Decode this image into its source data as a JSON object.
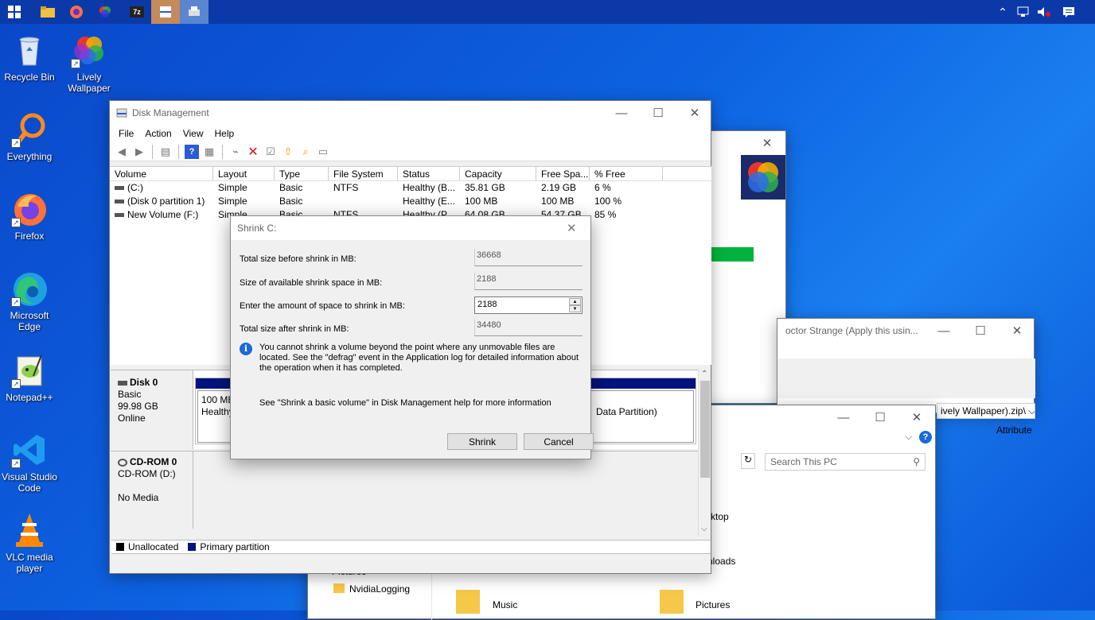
{
  "desktop_icons": [
    {
      "label": "Recycle Bin",
      "icon": "recycle-bin-icon"
    },
    {
      "label": "Lively Wallpaper",
      "icon": "lively-wallpaper-icon"
    },
    {
      "label": "Everything",
      "icon": "everything-search-icon"
    },
    {
      "label": "Firefox",
      "icon": "firefox-icon"
    },
    {
      "label": "Microsoft Edge",
      "icon": "edge-icon"
    },
    {
      "label": "Notepad++",
      "icon": "notepadpp-icon"
    },
    {
      "label": "Visual Studio Code",
      "icon": "vscode-icon"
    },
    {
      "label": "VLC media player",
      "icon": "vlc-icon"
    }
  ],
  "disk_mgmt": {
    "title": "Disk Management",
    "menu": [
      "File",
      "Action",
      "View",
      "Help"
    ],
    "columns": [
      "Volume",
      "Layout",
      "Type",
      "File System",
      "Status",
      "Capacity",
      "Free Spa...",
      "% Free"
    ],
    "rows": [
      [
        "(C:)",
        "Simple",
        "Basic",
        "NTFS",
        "Healthy (B...",
        "35.81 GB",
        "2.19 GB",
        "6 %"
      ],
      [
        "(Disk 0 partition 1)",
        "Simple",
        "Basic",
        "",
        "Healthy (E...",
        "100 MB",
        "100 MB",
        "100 %"
      ],
      [
        "New Volume (F:)",
        "Simple",
        "Basic",
        "NTFS",
        "Healthy (P...",
        "64.08 GB",
        "54.37 GB",
        "85 %"
      ]
    ],
    "disk0": {
      "name": "Disk 0",
      "type": "Basic",
      "size": "99.98 GB",
      "status": "Online",
      "part1_line1": "100 MB",
      "part1_line2": "Healthy",
      "part3": "Data Partition)"
    },
    "cdrom": {
      "name": "CD-ROM 0",
      "type": "CD-ROM (D:)",
      "status": "No Media"
    },
    "legend": {
      "unallocated": "Unallocated",
      "primary": "Primary partition"
    }
  },
  "shrink": {
    "title": "Shrink C:",
    "total_before_label": "Total size before shrink in MB:",
    "total_before": "36668",
    "available_label": "Size of available shrink space in MB:",
    "available": "2188",
    "amount_label": "Enter the amount of space to shrink in MB:",
    "amount": "2188",
    "total_after_label": "Total size after shrink in MB:",
    "total_after": "34480",
    "info": "You cannot shrink a volume beyond the point where any unmovable files are located. See the \"defrag\" event in the Application log for detailed information about the operation when it has completed.",
    "help": "See \"Shrink a basic volume\" in Disk Management help for more information",
    "shrink_btn": "Shrink",
    "cancel_btn": "Cancel"
  },
  "bg_window": {
    "title_fragment": "octor Strange (Apply this usin...",
    "zip_fragment": "ively Wallpaper).zip\\",
    "attribute_label": "Attribute"
  },
  "explorer": {
    "search_placeholder": "Search This PC",
    "nav_items": [
      "Pictures",
      "NvidiaLogging"
    ],
    "folders": [
      "Music",
      "Pictures"
    ],
    "fragments": [
      "ktop",
      "nloads"
    ]
  },
  "colors": {
    "accent_green": "#00b33c",
    "primary_partition": "#00137f"
  }
}
